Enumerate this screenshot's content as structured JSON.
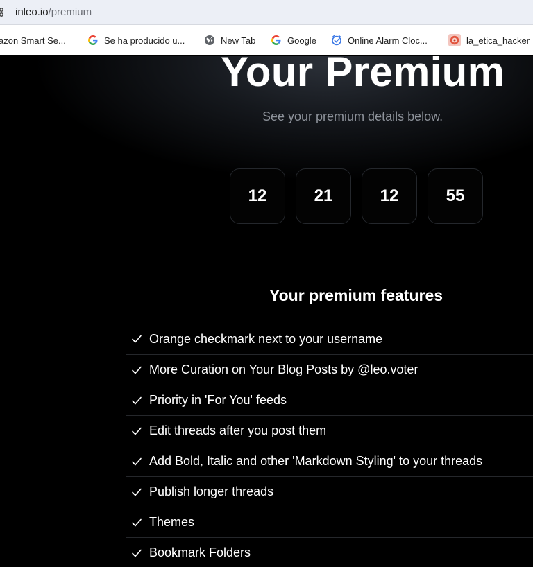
{
  "browser": {
    "url_domain": "inleo.io",
    "url_path": "/premium",
    "bookmarks": [
      {
        "label": "azon Smart Se...",
        "icon": "none"
      },
      {
        "label": "Se ha producido u...",
        "icon": "google-icon"
      },
      {
        "label": "New Tab",
        "icon": "globe-icon"
      },
      {
        "label": "Google",
        "icon": "google-icon"
      },
      {
        "label": "Online Alarm Cloc...",
        "icon": "alarm-check-icon"
      },
      {
        "label": "la_etica_hacker",
        "icon": "hacker-avatar-icon"
      }
    ]
  },
  "page": {
    "title": "Your Premium",
    "subtitle": "See your premium details below.",
    "countdown": [
      "12",
      "21",
      "12",
      "55"
    ],
    "features_title": "Your premium features",
    "features": [
      "Orange checkmark next to your username",
      "More Curation on Your Blog Posts by @leo.voter",
      "Priority in 'For You' feeds",
      "Edit threads after you post them",
      "Add Bold, Italic and other 'Markdown Styling' to your threads",
      "Publish longer threads",
      "Themes",
      "Bookmark Folders"
    ]
  },
  "colors": {
    "background": "#000000",
    "text": "#ffffff",
    "subtitle": "#8e939b",
    "tile_border": "#24272c"
  }
}
